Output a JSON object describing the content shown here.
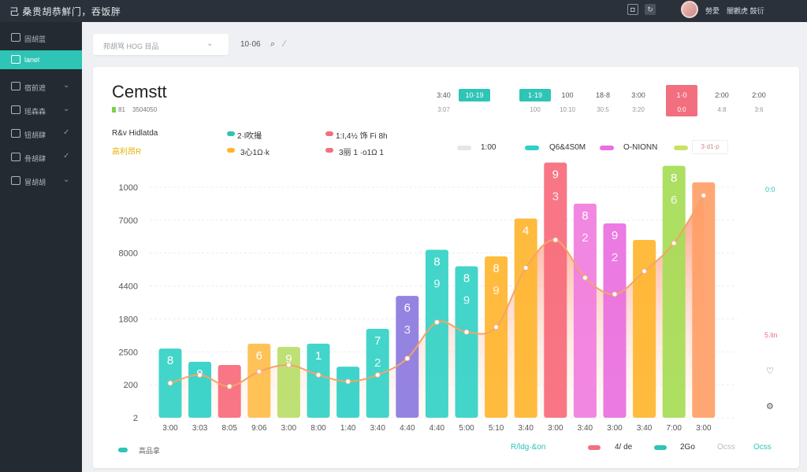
{
  "topbar": {
    "title": "己 桑贵胡恭鮮门，吞饭胖",
    "user_a": "勞愛",
    "user_b": "闇觀虎 鼓衍"
  },
  "sidebar": {
    "items": [
      {
        "label": "固胡蓝"
      },
      {
        "label": "lanel"
      },
      {
        "label": "宿前遮"
      },
      {
        "label": "瑶森森"
      },
      {
        "label": "钮胡肆"
      },
      {
        "label": "骨胡肆"
      },
      {
        "label": "冒胡胡"
      }
    ]
  },
  "toolbar": {
    "filter_placeholder": "邦胡骂 HOG 目品",
    "number": "10·06"
  },
  "chart_data": {
    "type": "bar",
    "title": "Cemstt",
    "categories": [
      "3:00",
      "3:03",
      "8:05",
      "9:06",
      "3:00",
      "8:00",
      "1:40",
      "3:40",
      "4:40",
      "4:40",
      "5:00",
      "5:10",
      "3:40",
      "3:00",
      "3:40",
      "3:00",
      "3:40",
      "7:00",
      "3:00"
    ],
    "values": [
      2100,
      1700,
      1600,
      2250,
      2150,
      2250,
      1550,
      2700,
      3700,
      5100,
      4600,
      4900,
      6050,
      7750,
      6500,
      5900,
      5400,
      7650,
      7150
    ],
    "bar_labels": [
      "8",
      "9",
      "",
      "6",
      "9",
      "1",
      "",
      "7",
      "6",
      "8",
      "8",
      "8",
      "4",
      "9",
      "8",
      "9",
      "",
      "8",
      ""
    ],
    "bar_labels_2": [
      "",
      "",
      "",
      "",
      "",
      "",
      "",
      "2",
      "3",
      "9",
      "9",
      "9",
      "",
      "3",
      "2",
      "2",
      "",
      "6",
      ""
    ],
    "bar_colors": [
      "#33d1c5",
      "#2ed0c7",
      "#f76a7b",
      "#ffbd4a",
      "#b8dd68",
      "#33d1c5",
      "#2ed0c7",
      "#33d1c5",
      "#8c78e0",
      "#33d1c5",
      "#33d1c5",
      "#ffb52e",
      "#ffb52e",
      "#f76a7b",
      "#f17de0",
      "#e96fdf",
      "#ffb52e",
      "#a6dc55",
      "#ff9f67"
    ],
    "line_values": [
      1050,
      1300,
      950,
      1400,
      1600,
      1300,
      1100,
      1300,
      1800,
      2900,
      2600,
      2750,
      4550,
      5400,
      4250,
      3750,
      4450,
      5300,
      6750
    ],
    "ylim": [
      0,
      7000
    ],
    "y_tick_labels": [
      "1000",
      "7000",
      "8000",
      "4400",
      "1800",
      "2500",
      "200",
      "2"
    ],
    "right_label_top": "0:0",
    "right_label_mid": "5.lin"
  },
  "header_info": [
    {
      "label": "R&v Hidlatda",
      "color": "#333333"
    },
    {
      "label": "高利昂R",
      "color": "#e8b000"
    },
    {
      "label": "2·l吹撮",
      "color": "#2ec4b6"
    },
    {
      "label": "3心1Ω·k",
      "color": "#ffb52e"
    },
    {
      "label": "1:I,4½ 饰 Fi 8h",
      "color": "#f26f80"
    },
    {
      "label": "3丽 1 ·o1Ω 1",
      "color": "#f26f80"
    }
  ],
  "periods": [
    {
      "top": "3:40",
      "bot": "3:07"
    },
    {
      "top": "10·19",
      "bot": ""
    },
    {
      "top": "1·19",
      "bot": "100"
    },
    {
      "top": "100",
      "bot": "10:10"
    },
    {
      "top": "18·8",
      "bot": "30:5"
    },
    {
      "top": "3:00",
      "bot": "3:20"
    },
    {
      "top": "1·0",
      "bot": "0:0"
    },
    {
      "top": "2:00",
      "bot": "4:8"
    },
    {
      "top": "2:00",
      "bot": "3:6"
    }
  ],
  "legend": [
    {
      "label": "1:00",
      "color": "#e6e6e6"
    },
    {
      "label": "Q6&4S0M",
      "color": "#2ed0c7"
    },
    {
      "label": "O-NIONN",
      "color": "#e96fdf"
    },
    {
      "label": "3·d1·p",
      "color": "#c9e265"
    }
  ],
  "bottom": {
    "left_label": "高品拿",
    "items": [
      {
        "label": "R/ldg·&on",
        "color": "#2ec4b6"
      },
      {
        "label": "4/ de",
        "color": "#f26f80"
      },
      {
        "label": "2Go",
        "color": "#2ec4b6"
      },
      {
        "label": "Ocss",
        "color": "#e6e6e6"
      }
    ]
  }
}
